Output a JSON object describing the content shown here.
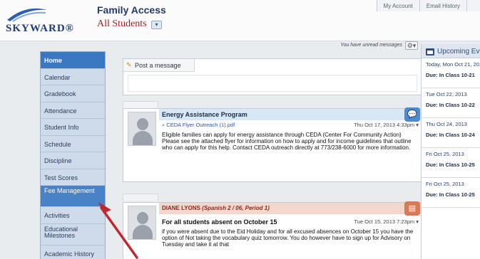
{
  "header": {
    "logo_text": "SKYWARD®",
    "app_title": "Family Access",
    "student_selector": "All Students",
    "links": [
      "My Account",
      "Email History",
      ""
    ]
  },
  "sidebar": {
    "items": [
      {
        "label": "Home"
      },
      {
        "label": "Calendar"
      },
      {
        "label": "Gradebook"
      },
      {
        "label": "Attendance"
      },
      {
        "label": "Student Info"
      },
      {
        "label": "Schedule"
      },
      {
        "label": "Discipline"
      },
      {
        "label": "Test Scores"
      },
      {
        "label": "Fee Management"
      },
      {
        "label": "Activities"
      },
      {
        "label": "Educational Milestones"
      },
      {
        "label": "Academic History"
      }
    ]
  },
  "main": {
    "unread_text": "You have unread messages",
    "post_label": "Post a message",
    "messages": [
      {
        "title": "Energy Assistance Program",
        "attachment": "CEDA Flyer Outreach (1).pdf",
        "date": "Thu Oct 17, 2013 4:33pm",
        "body": "Eligible families can apply for energy assistance through CEDA (Center For Community Action)  Please see the attached flyer for information on how to apply and for income guidelines that outline who can apply for this help.  Contact CEDA outreach directly at 773/238-6000 for more information."
      },
      {
        "sender": "DIANE LYONS",
        "course": "(Spanish 2 / 06, Period 1)",
        "heading": "For all students absent on October 15",
        "date": "Tue Oct 15, 2013 7:23pm",
        "body": "if you were absent due to the Eid Holiday and for all excused absences on October 15 you have the option of Not taking the vocabulary quiz tomorrow. You do however have to sign up for Advisory on Tuesday and take it at that"
      }
    ]
  },
  "upcoming": {
    "title": "Upcoming Events",
    "events": [
      {
        "date": "Today, Mon Oct 21, 2013",
        "item": "Due: In Class 10-21"
      },
      {
        "date": "Tue Oct 22, 2013",
        "item": "Due: In Class 10-22"
      },
      {
        "date": "Thu Oct 24, 2013",
        "item": "Due: In Class 10-24"
      },
      {
        "date": "Fri Oct 25, 2013",
        "item": "Due: In Class 10-25"
      },
      {
        "date": "Fri Oct 25, 2013",
        "item": "Due: In Class 10-25"
      }
    ]
  },
  "colors": {
    "nav_active": "#3a78c2",
    "nav_bg": "#cfdbea",
    "msg1_bar": "#d7e7f6",
    "msg2_bar": "#f3d6cc",
    "annotation_arrow": "#c0282d"
  }
}
